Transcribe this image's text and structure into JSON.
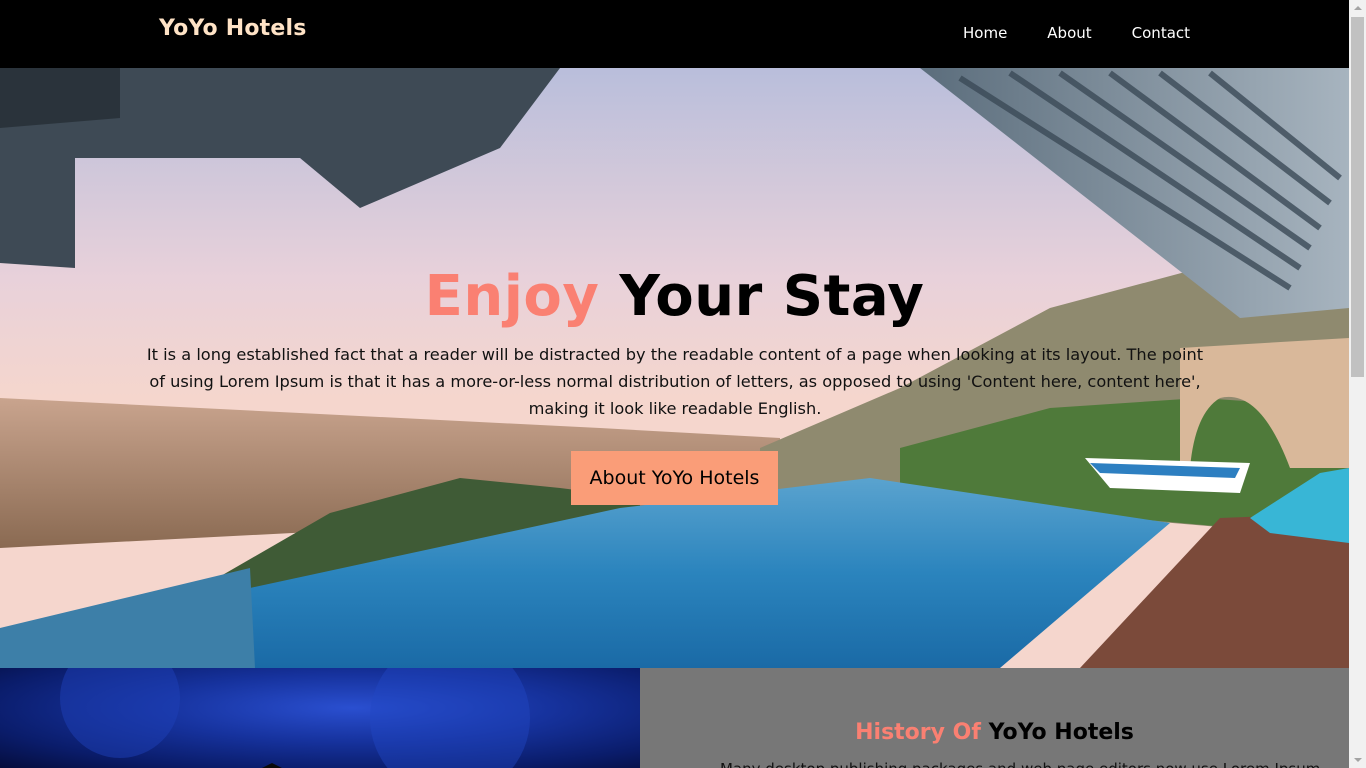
{
  "navbar": {
    "brand": "YoYo Hotels",
    "links": [
      "Home",
      "About",
      "Contact"
    ]
  },
  "hero": {
    "title_accent": "Enjoy",
    "title_rest": " Your Stay",
    "text": "It is a long established fact that a reader will be distracted by the readable content of a page when looking at its layout. The point of using Lorem Ipsum is that it has a more-or-less normal distribution of letters, as opposed to using 'Content here, content here', making it look like readable English.",
    "button_label": "About YoYo Hotels"
  },
  "history": {
    "title_accent": "History Of",
    "title_rest": " YoYo Hotels",
    "text": "Many desktop publishing packages and web page editors now use Lorem Ipsum"
  },
  "colors": {
    "accent": "#fa8072",
    "button": "#fa9d78",
    "brand": "#ffe3c6",
    "navbar_bg": "#000000",
    "panel_bg": "#777777"
  }
}
